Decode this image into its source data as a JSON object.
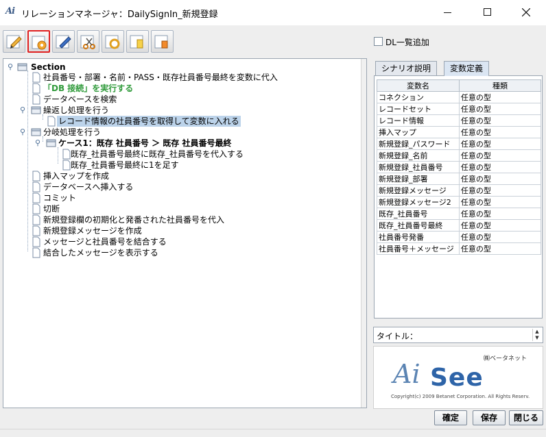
{
  "window": {
    "app_icon_text": "Ai",
    "title": "リレーションマネージャ：DailySignIn_新規登録"
  },
  "toolbar": {
    "buttons": [
      {
        "icon": "edit-pencil-icon",
        "selected": false
      },
      {
        "icon": "settings-gear-icon",
        "selected": true
      },
      {
        "icon": "blue-pen-icon",
        "selected": false
      },
      {
        "icon": "scissors-icon",
        "selected": false
      },
      {
        "icon": "refresh-icon",
        "selected": false
      },
      {
        "icon": "copy-icon",
        "selected": false
      },
      {
        "icon": "export-icon",
        "selected": false
      }
    ],
    "dl_add_label": "DL一覧追加"
  },
  "tree": {
    "root": "Section",
    "items": [
      "社員番号・部署・名前・PASS・既存社員番号最終を変数に代入",
      "「DB 接続」を実行する",
      "データベースを検索",
      "繰返し処理を行う",
      "レコード情報の社員番号を取得して変数に入れる",
      "分岐処理を行う",
      "ケース1：既存 社員番号 ＞ 既存 社員番号最終",
      "既存_社員番号最終に既存_社員番号を代入する",
      "既存_社員番号最終に1を足す",
      "挿入マップを作成",
      "データベースへ挿入する",
      "コミット",
      "切断",
      "新規登録欄の初期化と発番された社員番号を代入",
      "新規登録メッセージを作成",
      "メッセージと社員番号を結合する",
      "結合したメッセージを表示する"
    ]
  },
  "tabs": [
    "シナリオ説明",
    "変数定義"
  ],
  "variables": {
    "headers": [
      "変数名",
      "種類"
    ],
    "rows": [
      [
        "コネクション",
        "任意の型"
      ],
      [
        "レコードセット",
        "任意の型"
      ],
      [
        "レコード情報",
        "任意の型"
      ],
      [
        "挿入マップ",
        "任意の型"
      ],
      [
        "新規登録_パスワード",
        "任意の型"
      ],
      [
        "新規登録_名前",
        "任意の型"
      ],
      [
        "新規登録_社員番号",
        "任意の型"
      ],
      [
        "新規登録_部署",
        "任意の型"
      ],
      [
        "新規登録メッセージ",
        "任意の型"
      ],
      [
        "新規登録メッセージ2",
        "任意の型"
      ],
      [
        "既存_社員番号",
        "任意の型"
      ],
      [
        "既存_社員番号最終",
        "任意の型"
      ],
      [
        "社員番号発番",
        "任意の型"
      ],
      [
        "社員番号＋メッセージ",
        "任意の型"
      ]
    ]
  },
  "title_field": {
    "label": "タイトル：",
    "value": ""
  },
  "logo": {
    "company": "㈱ベータネット",
    "ai": "Ai",
    "see": "See",
    "copyright": "Copyright(c) 2009 Betanet Corporation. All Rights Reserv."
  },
  "buttons": {
    "confirm": "確定",
    "save": "保存",
    "close": "閉じる"
  }
}
